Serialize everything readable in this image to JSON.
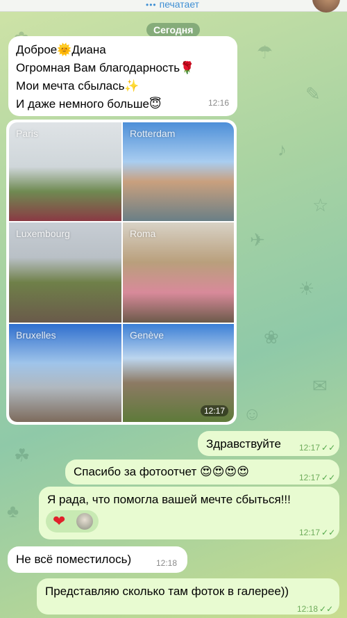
{
  "header": {
    "status": "печатает"
  },
  "date_label": "Сегодня",
  "messages": {
    "first": {
      "lines": [
        "Доброе🌞Диана",
        "Огромная Вам благодарность🌹",
        "Мои мечта сбылась✨",
        "И даже немного больше😇"
      ],
      "time": "12:16"
    },
    "album": {
      "photos": [
        {
          "caption": "Paris"
        },
        {
          "caption": "Rotterdam"
        },
        {
          "caption": "Luxembourg"
        },
        {
          "caption": "Roma"
        },
        {
          "caption": "Bruxelles"
        },
        {
          "caption": "Genève"
        }
      ],
      "time": "12:17"
    },
    "hello": {
      "text": "Здравствуйте",
      "time": "12:17"
    },
    "thanks": {
      "text": "Спасибо за фотоотчет 😍😍😍😍",
      "time": "12:17"
    },
    "glad": {
      "text": "Я рада, что помогла вашей мечте сбыться!!!",
      "time": "12:17",
      "reaction": "❤"
    },
    "not_all": {
      "text": "Не всё поместилось)",
      "time": "12:18"
    },
    "gallery": {
      "text": "Представляю сколько там фоток в галерее))",
      "time": "12:18"
    }
  },
  "colors": {
    "incoming": "#ffffff",
    "outgoing": "#e8fbd1",
    "accent": "#3f8fd4",
    "check": "#52a84a"
  }
}
